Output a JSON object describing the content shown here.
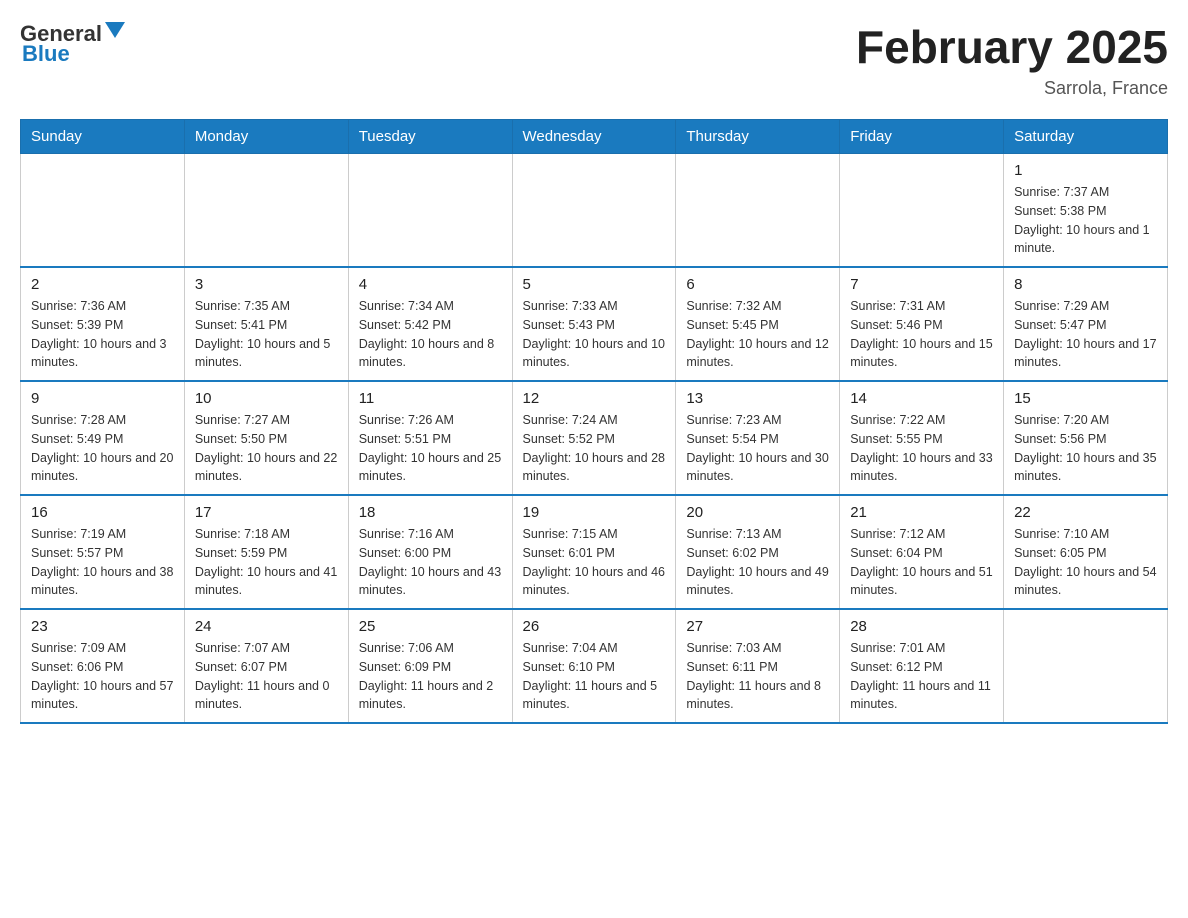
{
  "header": {
    "logo": {
      "general": "General",
      "blue": "Blue"
    },
    "title": "February 2025",
    "location": "Sarrola, France"
  },
  "weekdays": [
    "Sunday",
    "Monday",
    "Tuesday",
    "Wednesday",
    "Thursday",
    "Friday",
    "Saturday"
  ],
  "weeks": [
    [
      {
        "day": "",
        "info": ""
      },
      {
        "day": "",
        "info": ""
      },
      {
        "day": "",
        "info": ""
      },
      {
        "day": "",
        "info": ""
      },
      {
        "day": "",
        "info": ""
      },
      {
        "day": "",
        "info": ""
      },
      {
        "day": "1",
        "info": "Sunrise: 7:37 AM\nSunset: 5:38 PM\nDaylight: 10 hours and 1 minute."
      }
    ],
    [
      {
        "day": "2",
        "info": "Sunrise: 7:36 AM\nSunset: 5:39 PM\nDaylight: 10 hours and 3 minutes."
      },
      {
        "day": "3",
        "info": "Sunrise: 7:35 AM\nSunset: 5:41 PM\nDaylight: 10 hours and 5 minutes."
      },
      {
        "day": "4",
        "info": "Sunrise: 7:34 AM\nSunset: 5:42 PM\nDaylight: 10 hours and 8 minutes."
      },
      {
        "day": "5",
        "info": "Sunrise: 7:33 AM\nSunset: 5:43 PM\nDaylight: 10 hours and 10 minutes."
      },
      {
        "day": "6",
        "info": "Sunrise: 7:32 AM\nSunset: 5:45 PM\nDaylight: 10 hours and 12 minutes."
      },
      {
        "day": "7",
        "info": "Sunrise: 7:31 AM\nSunset: 5:46 PM\nDaylight: 10 hours and 15 minutes."
      },
      {
        "day": "8",
        "info": "Sunrise: 7:29 AM\nSunset: 5:47 PM\nDaylight: 10 hours and 17 minutes."
      }
    ],
    [
      {
        "day": "9",
        "info": "Sunrise: 7:28 AM\nSunset: 5:49 PM\nDaylight: 10 hours and 20 minutes."
      },
      {
        "day": "10",
        "info": "Sunrise: 7:27 AM\nSunset: 5:50 PM\nDaylight: 10 hours and 22 minutes."
      },
      {
        "day": "11",
        "info": "Sunrise: 7:26 AM\nSunset: 5:51 PM\nDaylight: 10 hours and 25 minutes."
      },
      {
        "day": "12",
        "info": "Sunrise: 7:24 AM\nSunset: 5:52 PM\nDaylight: 10 hours and 28 minutes."
      },
      {
        "day": "13",
        "info": "Sunrise: 7:23 AM\nSunset: 5:54 PM\nDaylight: 10 hours and 30 minutes."
      },
      {
        "day": "14",
        "info": "Sunrise: 7:22 AM\nSunset: 5:55 PM\nDaylight: 10 hours and 33 minutes."
      },
      {
        "day": "15",
        "info": "Sunrise: 7:20 AM\nSunset: 5:56 PM\nDaylight: 10 hours and 35 minutes."
      }
    ],
    [
      {
        "day": "16",
        "info": "Sunrise: 7:19 AM\nSunset: 5:57 PM\nDaylight: 10 hours and 38 minutes."
      },
      {
        "day": "17",
        "info": "Sunrise: 7:18 AM\nSunset: 5:59 PM\nDaylight: 10 hours and 41 minutes."
      },
      {
        "day": "18",
        "info": "Sunrise: 7:16 AM\nSunset: 6:00 PM\nDaylight: 10 hours and 43 minutes."
      },
      {
        "day": "19",
        "info": "Sunrise: 7:15 AM\nSunset: 6:01 PM\nDaylight: 10 hours and 46 minutes."
      },
      {
        "day": "20",
        "info": "Sunrise: 7:13 AM\nSunset: 6:02 PM\nDaylight: 10 hours and 49 minutes."
      },
      {
        "day": "21",
        "info": "Sunrise: 7:12 AM\nSunset: 6:04 PM\nDaylight: 10 hours and 51 minutes."
      },
      {
        "day": "22",
        "info": "Sunrise: 7:10 AM\nSunset: 6:05 PM\nDaylight: 10 hours and 54 minutes."
      }
    ],
    [
      {
        "day": "23",
        "info": "Sunrise: 7:09 AM\nSunset: 6:06 PM\nDaylight: 10 hours and 57 minutes."
      },
      {
        "day": "24",
        "info": "Sunrise: 7:07 AM\nSunset: 6:07 PM\nDaylight: 11 hours and 0 minutes."
      },
      {
        "day": "25",
        "info": "Sunrise: 7:06 AM\nSunset: 6:09 PM\nDaylight: 11 hours and 2 minutes."
      },
      {
        "day": "26",
        "info": "Sunrise: 7:04 AM\nSunset: 6:10 PM\nDaylight: 11 hours and 5 minutes."
      },
      {
        "day": "27",
        "info": "Sunrise: 7:03 AM\nSunset: 6:11 PM\nDaylight: 11 hours and 8 minutes."
      },
      {
        "day": "28",
        "info": "Sunrise: 7:01 AM\nSunset: 6:12 PM\nDaylight: 11 hours and 11 minutes."
      },
      {
        "day": "",
        "info": ""
      }
    ]
  ]
}
